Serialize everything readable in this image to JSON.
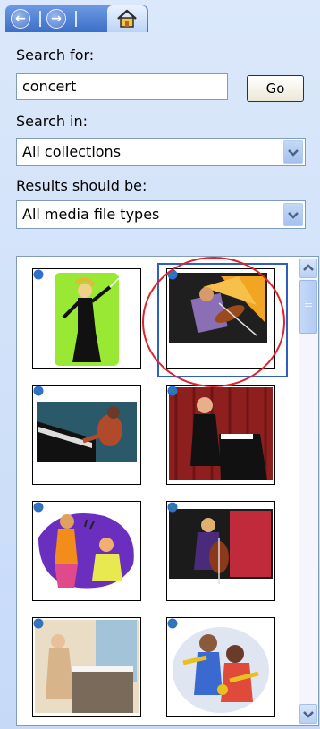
{
  "nav": {
    "back_icon": "back-arrow-icon",
    "forward_icon": "forward-arrow-icon",
    "home_icon": "home-icon"
  },
  "search": {
    "label": "Search for:",
    "value": "concert",
    "go_label": "Go"
  },
  "search_in": {
    "label": "Search in:",
    "selected": "All collections"
  },
  "results_type": {
    "label": "Results should be:",
    "selected": "All media file types"
  },
  "results": {
    "items": [
      {
        "subject": "conductor with baton",
        "selected": false
      },
      {
        "subject": "violinist",
        "selected": true
      },
      {
        "subject": "pianist at keyboard",
        "selected": false
      },
      {
        "subject": "pianist at grand piano",
        "selected": false
      },
      {
        "subject": "singers performing",
        "selected": false
      },
      {
        "subject": "cellist",
        "selected": false
      },
      {
        "subject": "pianist at piano",
        "selected": false
      },
      {
        "subject": "jazz trumpet players",
        "selected": false
      }
    ],
    "badge_icon": "globe-icon"
  },
  "colors": {
    "panel_bg": "#c6daf7",
    "selection_border": "#2c5fbf",
    "highlight_circle": "#e0232a"
  }
}
